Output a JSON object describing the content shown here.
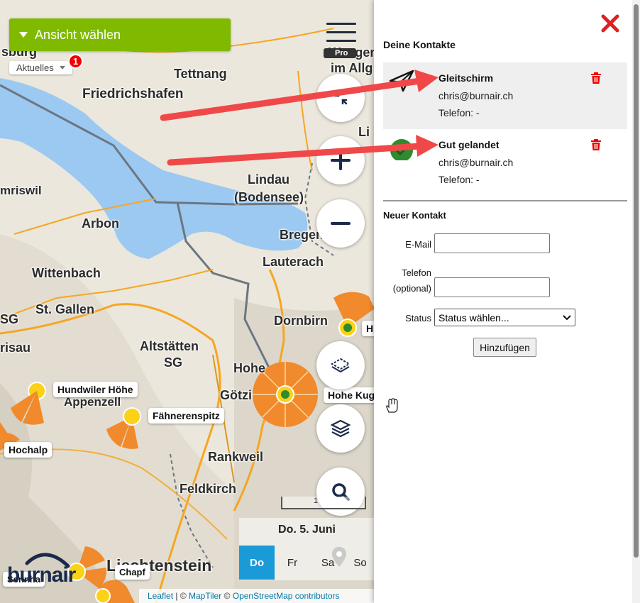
{
  "map": {
    "view_select_label": "Ansicht wählen",
    "time_select_label": "Aktuelles",
    "notification_count": "1",
    "pro_badge": "Pro",
    "places": {
      "burg": "sburg",
      "wangen": "Wangen",
      "imallg": "im Allg",
      "tettnang": "Tettnang",
      "friedrichshafen": "Friedrichshafen",
      "lindau": "Lindau",
      "bodensee": "(Bodensee)",
      "li": "Li",
      "mriswil": "mriswil",
      "arbon": "Arbon",
      "bregenz": "Bregen",
      "lauterach": "Lauterach",
      "wittenbach": "Wittenbach",
      "sg1": "SG",
      "stgallen": "St. Gallen",
      "dornbirn": "Dornbirn",
      "risau": "risau",
      "altstaetten": "Altstätten",
      "sg2": "SG",
      "hohenems": "Hohe",
      "goetzis": "Götzi",
      "appenzell": "Appenzell",
      "rankweil": "Rankweil",
      "feldkirch": "Feldkirch",
      "liechtenstein": "Liechtenstein"
    },
    "spots": {
      "hundwiler": "Hundwiler Höhe",
      "faehnerenspitz": "Fähnerenspitz",
      "hochalp": "Hochalp",
      "hohe_kugel": "Hohe Kug",
      "h": "H",
      "chapf": "Chapf",
      "sennha": "Sennha"
    },
    "scale_label": "1",
    "date_title": "Do. 5. Juni",
    "days": [
      "Do",
      "Fr",
      "Sa",
      "So"
    ],
    "logo_text": "burnair",
    "attribution": {
      "leaflet": "Leaflet",
      "sep": " | © ",
      "maptiler": "MapTiler",
      "sep2": " © ",
      "osm": "OpenStreetMap contributors"
    },
    "colors": {
      "water": "#9bc9f2",
      "green_button": "#7fba00",
      "active_day": "#1a9bd7",
      "spot_orange": "#f08a2c"
    }
  },
  "panel": {
    "title": "Deine Kontakte",
    "contacts": [
      {
        "name": "Gleitschirm",
        "email": "chris@burnair.ch",
        "phone": "Telefon: -",
        "icon": "paper-plane-icon"
      },
      {
        "name": "Gut gelandet",
        "email": "chris@burnair.ch",
        "phone": "Telefon: -",
        "icon": "landed-check-icon"
      }
    ],
    "new_contact": {
      "title": "Neuer Kontakt",
      "email_label": "E-Mail",
      "email_value": "",
      "phone_label_1": "Telefon",
      "phone_label_2": "(optional)",
      "phone_value": "",
      "status_label": "Status",
      "status_value": "Status wählen...",
      "submit_label": "Hinzufügen"
    }
  }
}
